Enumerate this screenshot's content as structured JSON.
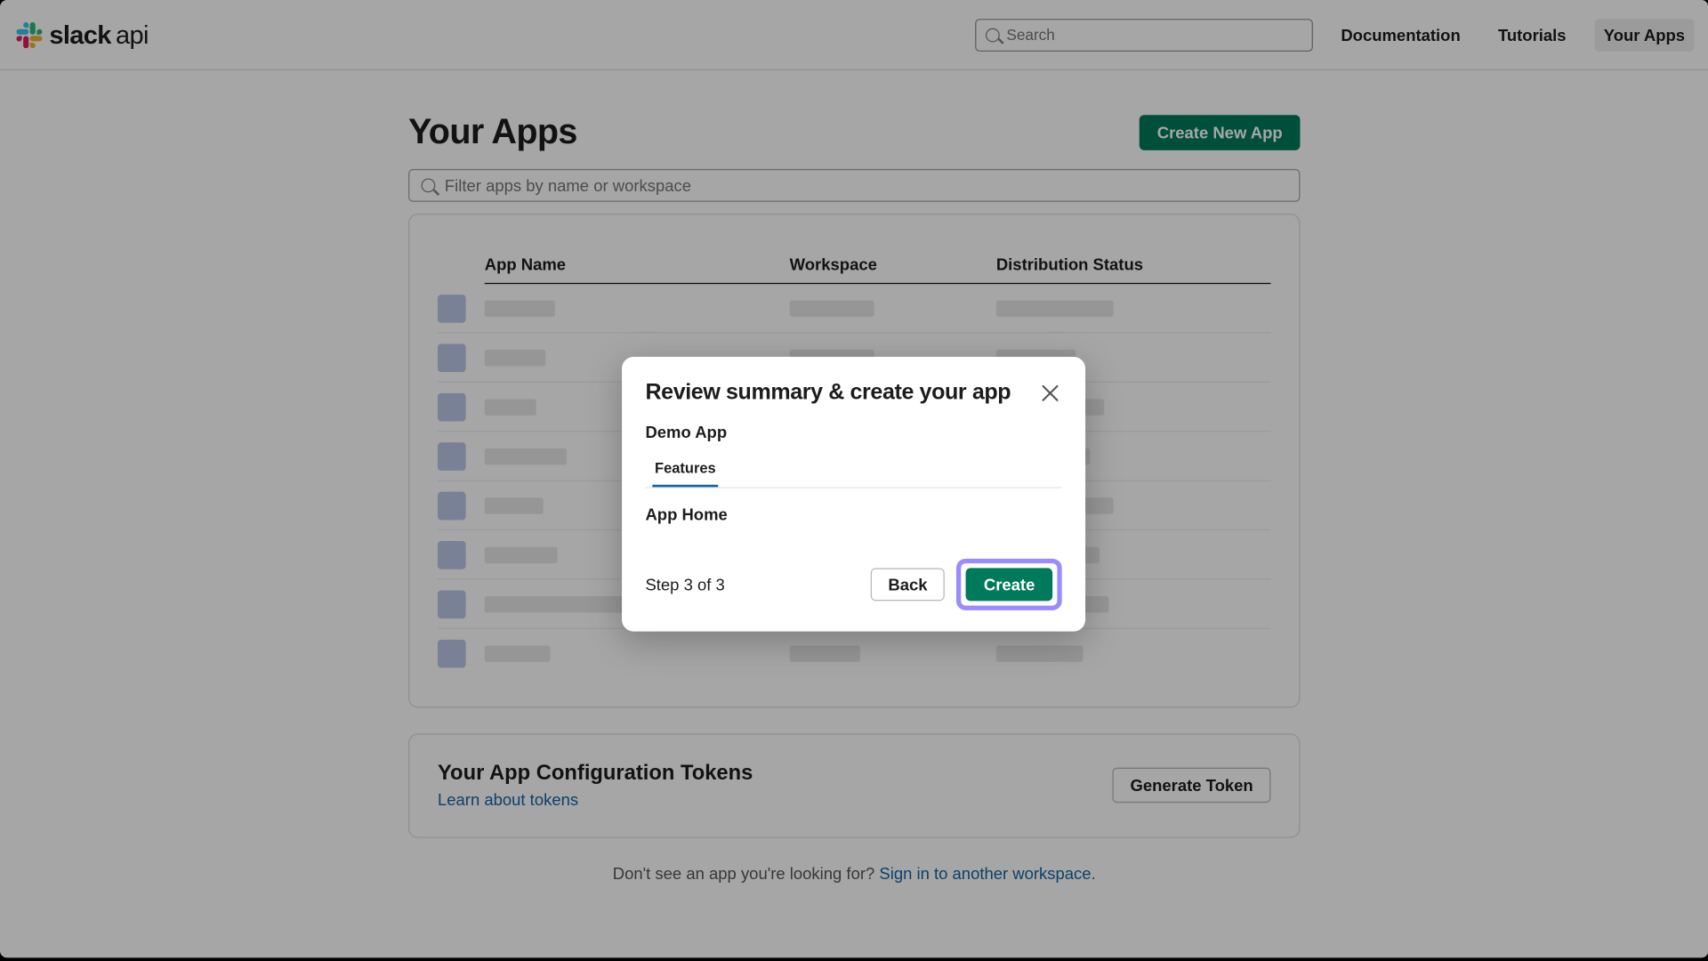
{
  "brand": {
    "name": "slack",
    "suffix": "api"
  },
  "nav": {
    "search_placeholder": "Search",
    "links": {
      "docs": "Documentation",
      "tutorials": "Tutorials",
      "your_apps": "Your Apps"
    }
  },
  "page": {
    "title": "Your Apps",
    "create_button": "Create New App",
    "filter_placeholder": "Filter apps by name or workspace",
    "table": {
      "cols": {
        "name": "App Name",
        "workspace": "Workspace",
        "dist": "Distribution Status"
      }
    },
    "tokens": {
      "title": "Your App Configuration Tokens",
      "learn_link": "Learn about tokens",
      "generate_btn": "Generate Token"
    },
    "foot": {
      "text": "Don't see an app you're looking for? ",
      "link": "Sign in to another workspace",
      "period": "."
    }
  },
  "modal": {
    "title": "Review summary & create your app",
    "app_name": "Demo App",
    "tab": "Features",
    "section": "App Home",
    "step": "Step 3 of 3",
    "back": "Back",
    "create": "Create"
  }
}
